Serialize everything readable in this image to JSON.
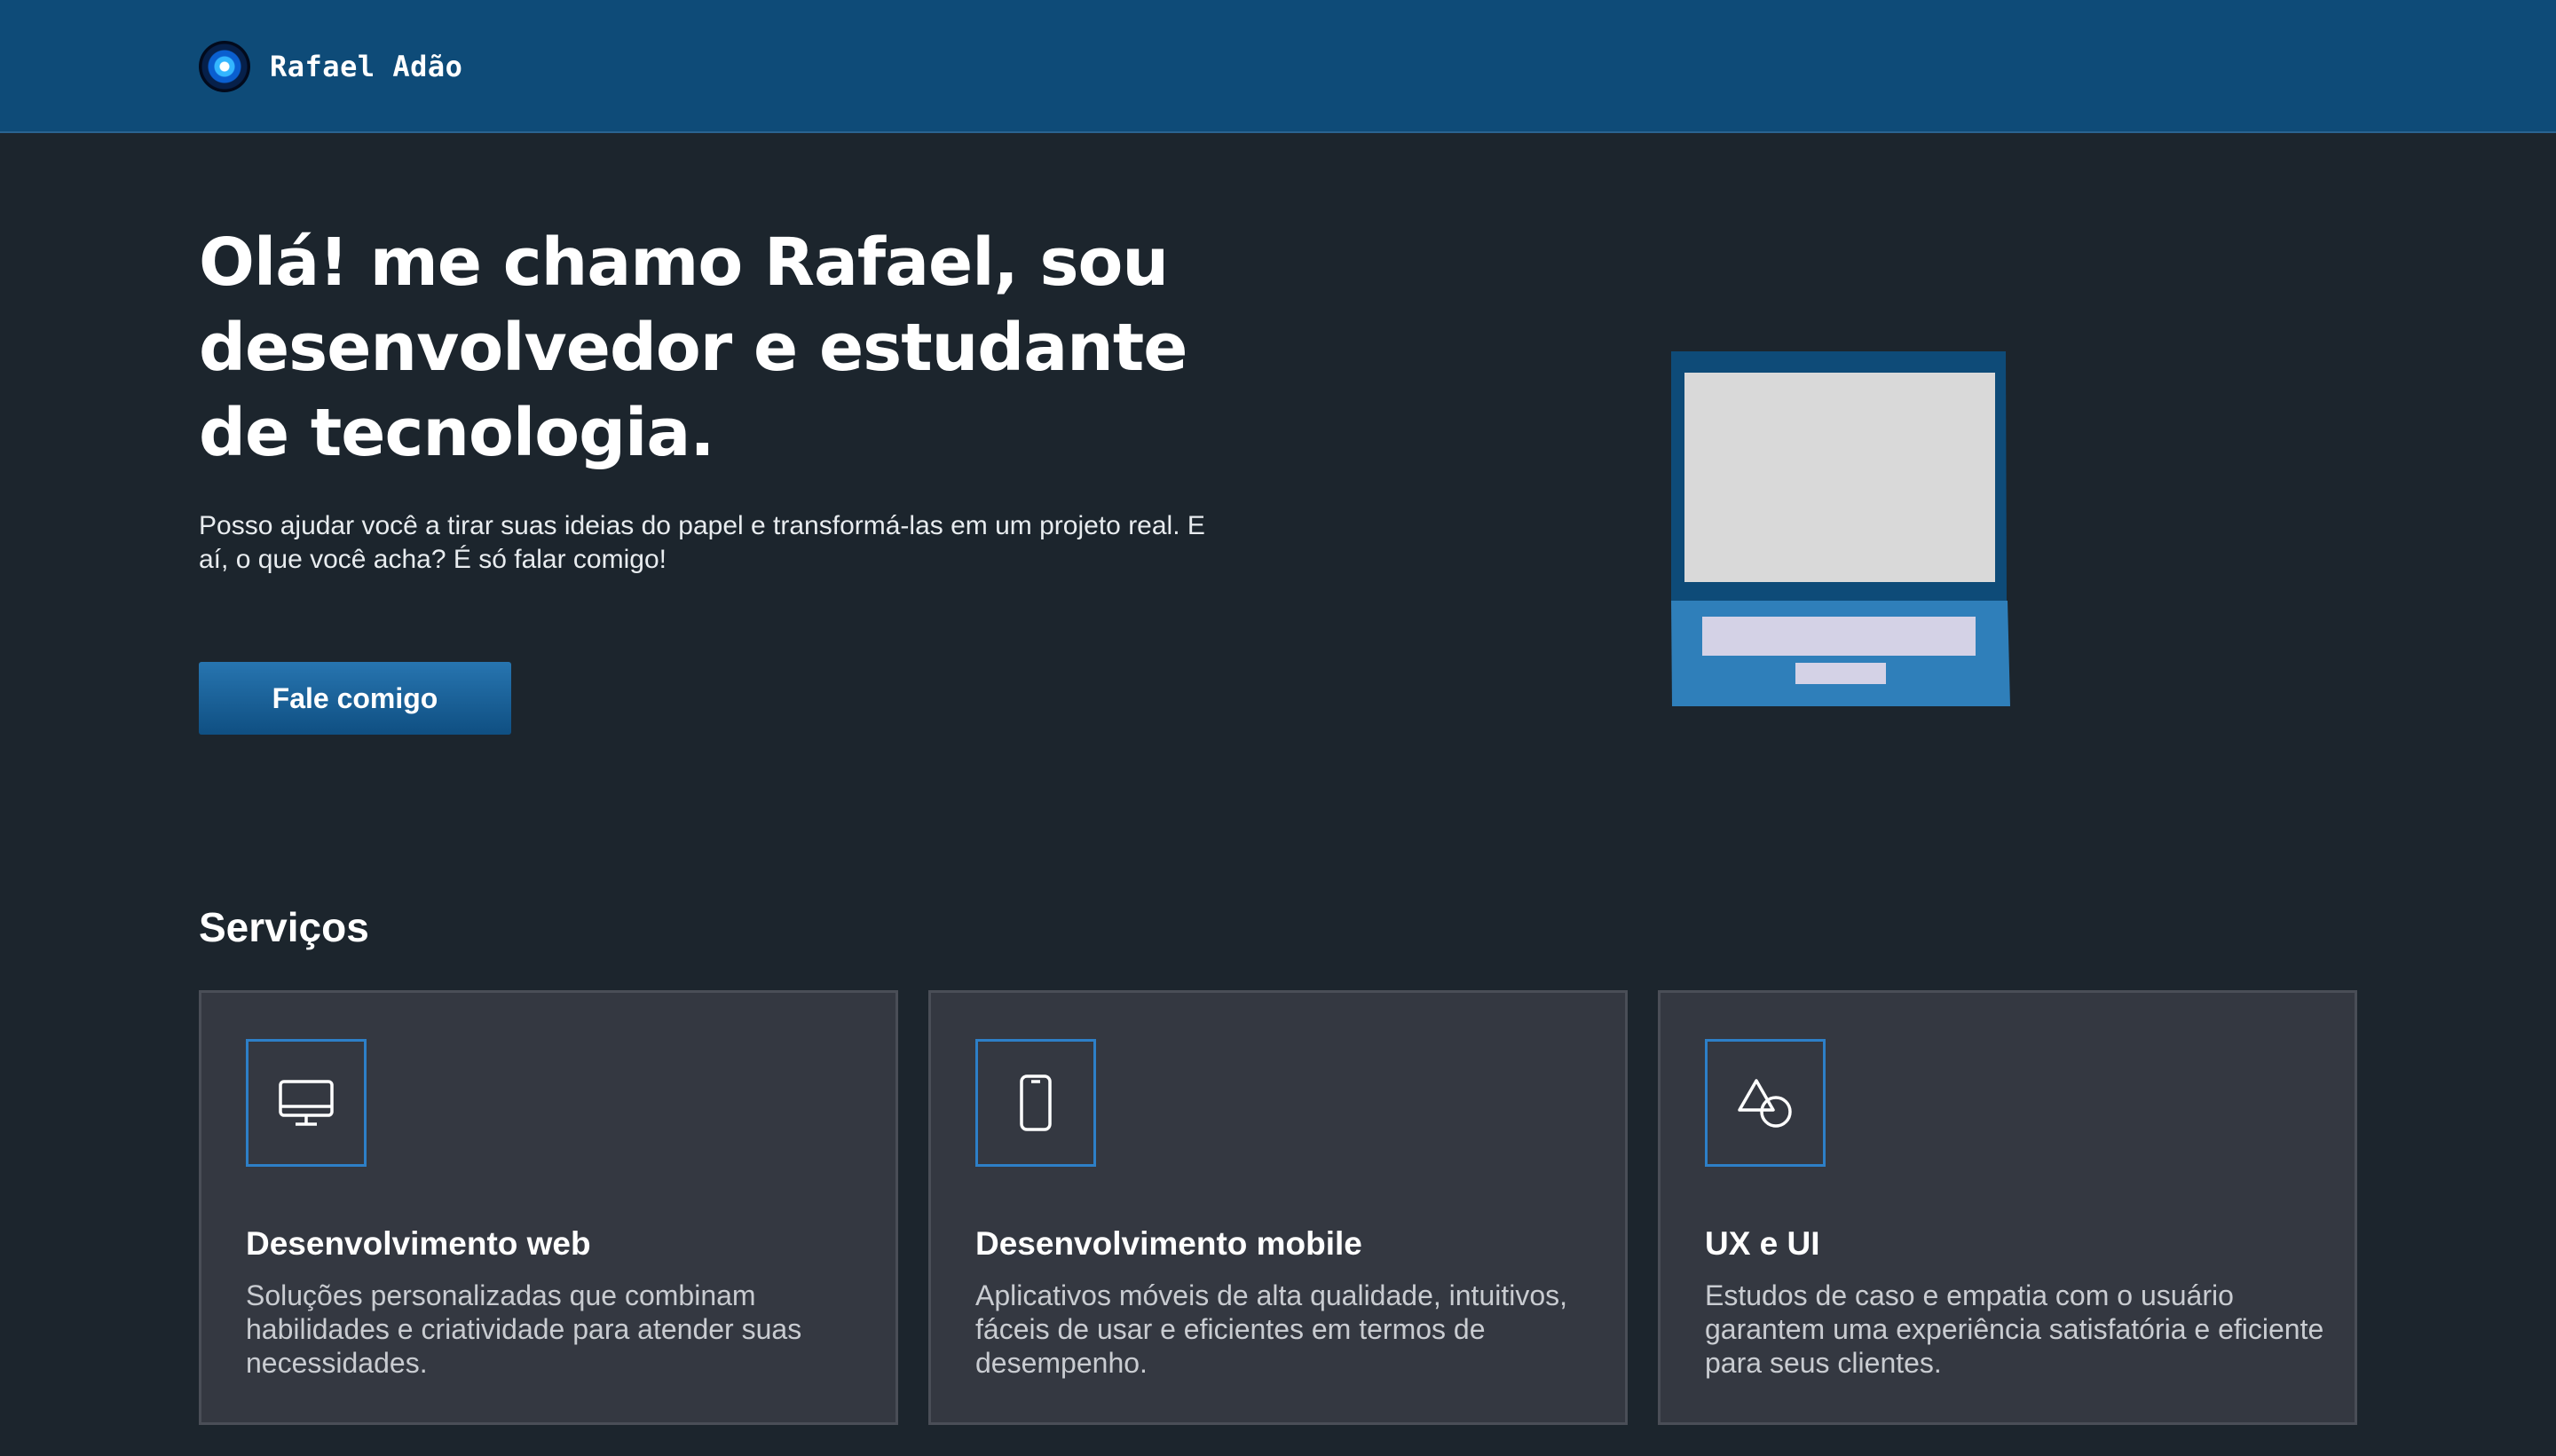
{
  "header": {
    "logo_name": "Rafael Adão"
  },
  "hero": {
    "title": "Olá! me chamo Rafael, sou desenvolvedor e estudante de tecnologia.",
    "text": "Posso ajudar você a tirar suas ideias do papel e transformá-las em um projeto real. E aí, o que você acha? É só falar comigo!",
    "cta_label": "Fale comigo",
    "illustration_icon": "laptop-illustration"
  },
  "services": {
    "title": "Serviços",
    "cards": [
      {
        "icon": "monitor-icon",
        "title": "Desenvolvimento web",
        "text": "Soluções personalizadas que combinam habilidades e criatividade para atender suas necessidades."
      },
      {
        "icon": "smartphone-icon",
        "title": "Desenvolvimento mobile",
        "text": "Aplicativos móveis de alta qualidade, intuitivos, fáceis de usar e eficientes em termos de desempenho."
      },
      {
        "icon": "shapes-icon",
        "title": "UX e UI",
        "text": "Estudos de caso e empatia com o usuário garantem uma experiência satisfatória e eficiente para seus clientes."
      }
    ]
  },
  "colors": {
    "header_bg": "#0e4b78",
    "page_bg": "#1c252d",
    "accent": "#2d7fc7",
    "card_bg": "#343841"
  }
}
